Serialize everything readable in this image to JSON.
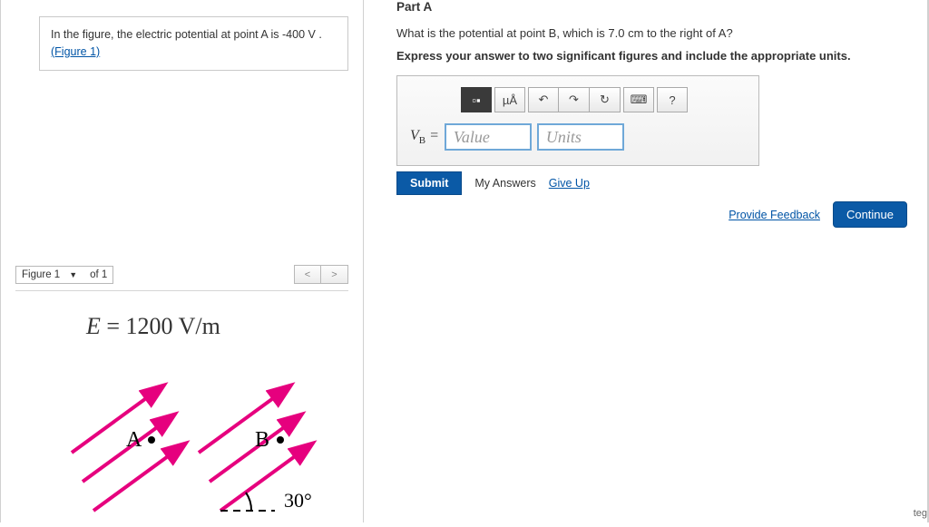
{
  "problem": {
    "text_pre": "In the figure, the electric potential at point A is -400 ",
    "unit": "V",
    "text_post": " .",
    "fig_link": "(Figure 1)"
  },
  "figure_nav": {
    "label": "Figure 1",
    "page": "of 1",
    "prev": "<",
    "next": ">"
  },
  "figure": {
    "equation_var": "E",
    "equation_eq": " = 1200 V/m",
    "pointA": "A",
    "pointB": "B",
    "angle": "30°"
  },
  "partA": {
    "title": "Part A",
    "question": "What is the potential at point B, which is 7.0  cm to the right of A?",
    "instruction": "Express your answer to two significant figures and include the appropriate units.",
    "var_label_html": "V<sub>B</sub> =",
    "value_placeholder": "Value",
    "units_placeholder": "Units",
    "toolbar": {
      "templates": "▫▪",
      "symbols": "µÅ",
      "undo": "↶",
      "redo": "↷",
      "reset": "↻",
      "keyboard": "⌨",
      "help": "?"
    },
    "submit": "Submit",
    "my_answers": "My Answers",
    "give_up": "Give Up"
  },
  "footer": {
    "provide_feedback": "Provide Feedback",
    "continue": "Continue"
  },
  "stray": "teg"
}
